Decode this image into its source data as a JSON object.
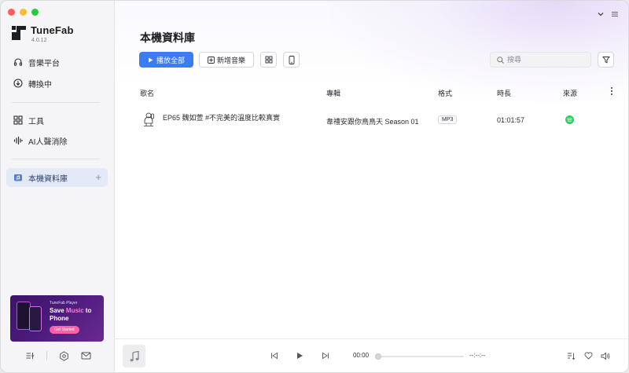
{
  "app": {
    "name": "TuneFab",
    "version": "4.0.12",
    "traffic_lights": [
      "#ff5f57",
      "#febc2e",
      "#28c840"
    ]
  },
  "sidebar": {
    "items": [
      {
        "label": "音樂平台",
        "icon": "headphones-icon"
      },
      {
        "label": "轉換中",
        "icon": "download-circle-icon"
      },
      {
        "label": "工具",
        "icon": "grid-icon"
      },
      {
        "label": "AI人聲消除",
        "icon": "waveform-icon"
      },
      {
        "label": "本機資料庫",
        "icon": "folder-music-icon",
        "active": true
      }
    ],
    "banner": {
      "brand": "TuneFab Player",
      "headline_pre": "Save ",
      "headline_hl": "Music",
      "headline_post": " to Phone",
      "cta": "Get Started"
    }
  },
  "main": {
    "title": "本機資料庫",
    "buttons": {
      "play_all": "播放全部",
      "add_music": "新增音樂"
    },
    "search": {
      "placeholder": "搜尋"
    },
    "table": {
      "headers": {
        "name": "歌名",
        "album": "專輯",
        "format": "格式",
        "duration": "時長",
        "source": "來源"
      },
      "rows": [
        {
          "name": "EP65 魏如萱 #不完美的溫度比較真實",
          "album": "韋禮安跟你鳥鳥天 Season 01",
          "format": "MP3",
          "duration": "01:01:57",
          "source": "spotify"
        }
      ]
    }
  },
  "player": {
    "current_time": "00:00",
    "total_time": "--:--:--",
    "progress": 0
  },
  "colors": {
    "accent": "#3b7cf5",
    "spotify": "#1ed760"
  }
}
